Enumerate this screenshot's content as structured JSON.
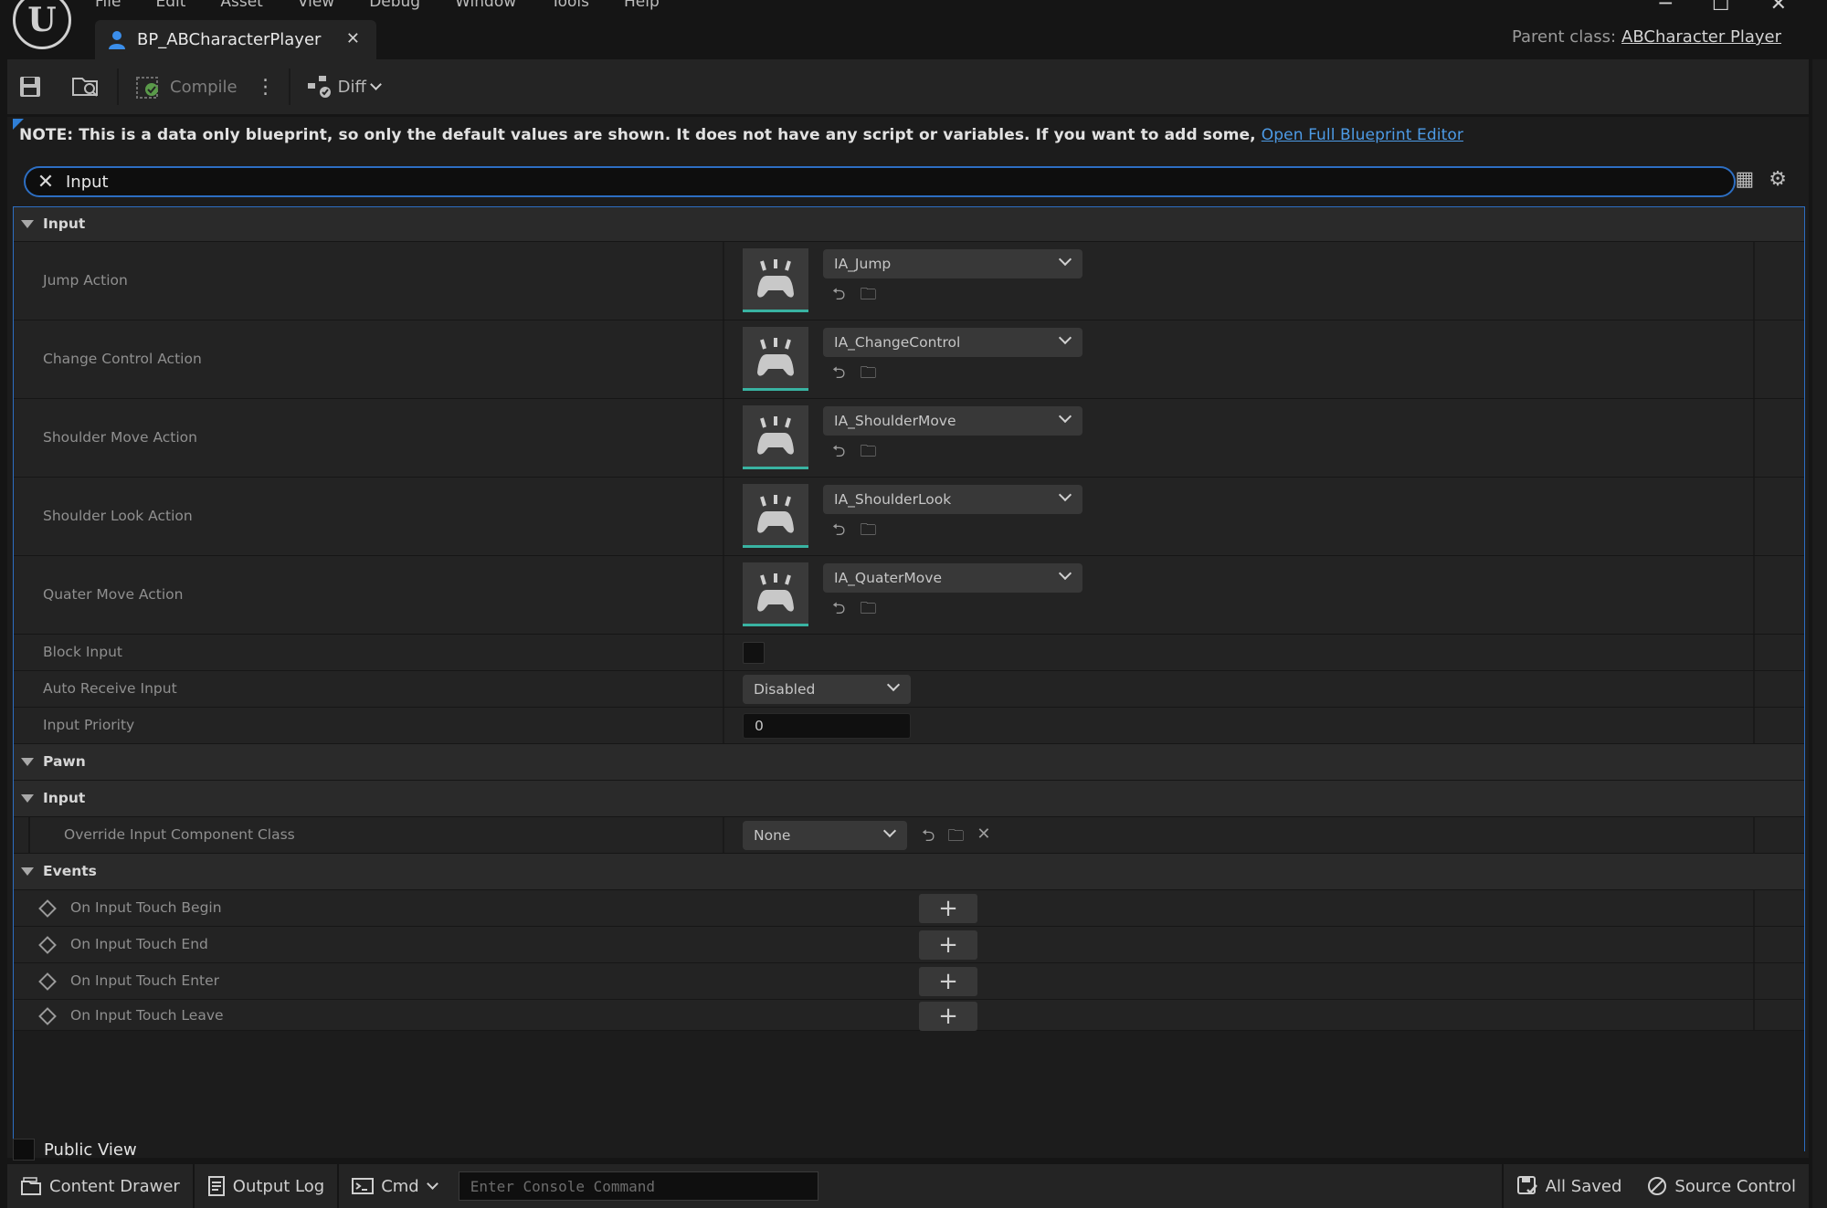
{
  "window": {
    "menu": [
      "File",
      "Edit",
      "Asset",
      "View",
      "Debug",
      "Window",
      "Tools",
      "Help"
    ],
    "tab_title": "BP_ABCharacterPlayer",
    "parent_class_label": "Parent class:",
    "parent_class_value": "ABCharacter Player"
  },
  "toolbar": {
    "compile_label": "Compile",
    "diff_label": "Diff"
  },
  "note": {
    "text": "NOTE: This is a data only blueprint, so only the default values are shown.  It does not have any script or variables.  If you want to add some,",
    "link": "Open Full Blueprint Editor"
  },
  "search": {
    "value": "Input"
  },
  "sections": {
    "input": "Input",
    "pawn": "Pawn",
    "pawn_input": "Input",
    "events": "Events"
  },
  "input_actions": [
    {
      "label": "Jump Action",
      "value": "IA_Jump"
    },
    {
      "label": "Change Control Action",
      "value": "IA_ChangeControl"
    },
    {
      "label": "Shoulder Move Action",
      "value": "IA_ShoulderMove"
    },
    {
      "label": "Shoulder Look Action",
      "value": "IA_ShoulderLook"
    },
    {
      "label": "Quater Move Action",
      "value": "IA_QuaterMove"
    }
  ],
  "block_input": {
    "label": "Block Input",
    "checked": false
  },
  "auto_receive_input": {
    "label": "Auto Receive Input",
    "value": "Disabled"
  },
  "input_priority": {
    "label": "Input Priority",
    "value": "0"
  },
  "override_input": {
    "label": "Override Input Component Class",
    "value": "None"
  },
  "events": [
    {
      "label": "On Input Touch Begin"
    },
    {
      "label": "On Input Touch End"
    },
    {
      "label": "On Input Touch Enter"
    },
    {
      "label": "On Input Touch Leave"
    }
  ],
  "public_view": "Public View",
  "statusbar": {
    "content_drawer": "Content Drawer",
    "output_log": "Output Log",
    "cmd": "Cmd",
    "console_placeholder": "Enter Console Command",
    "all_saved": "All Saved",
    "source_control": "Source Control"
  },
  "colors": {
    "accent_blue": "#2d6ec2",
    "link_blue": "#4d9be6",
    "thumb_underline": "#39b3a2"
  }
}
